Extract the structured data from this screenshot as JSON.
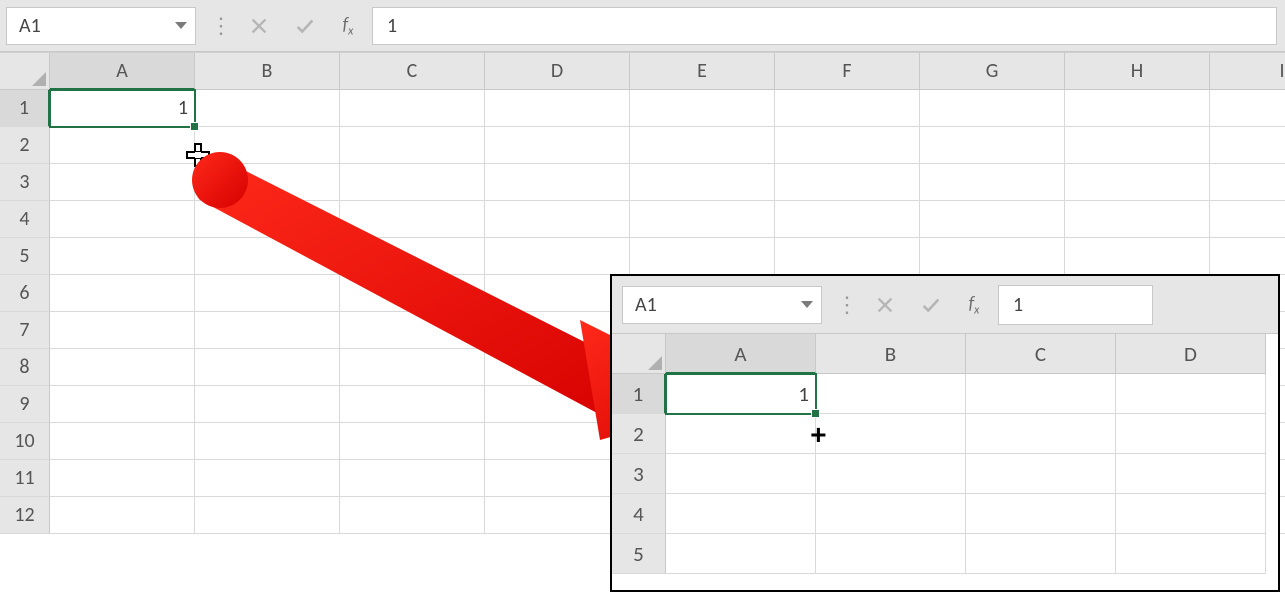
{
  "main": {
    "namebox": "A1",
    "formula": "1",
    "columns": [
      "A",
      "B",
      "C",
      "D",
      "E",
      "F",
      "G",
      "H",
      "I"
    ],
    "rows": [
      "1",
      "2",
      "3",
      "4",
      "5",
      "6",
      "7",
      "8",
      "9",
      "10",
      "11",
      "12"
    ],
    "active_cell_value": "1",
    "active_col_index": 0,
    "active_row_index": 0
  },
  "inset": {
    "namebox": "A1",
    "formula": "1",
    "columns": [
      "A",
      "B",
      "C",
      "D"
    ],
    "rows": [
      "1",
      "2",
      "3",
      "4",
      "5"
    ],
    "active_cell_value": "1"
  },
  "icons": {
    "cancel": "✕",
    "confirm": "✓",
    "fx": "fx"
  }
}
